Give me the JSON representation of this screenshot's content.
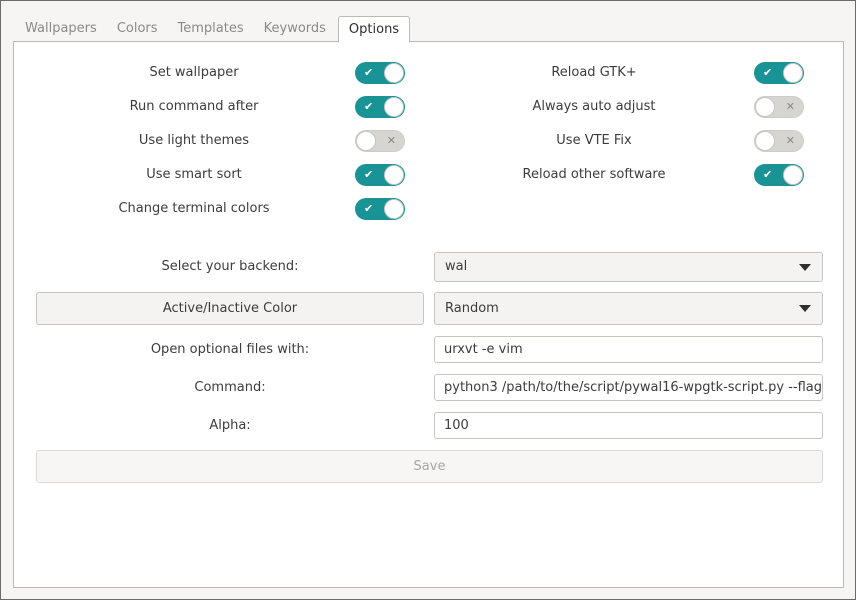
{
  "tabs": [
    {
      "label": "Wallpapers",
      "active": false
    },
    {
      "label": "Colors",
      "active": false
    },
    {
      "label": "Templates",
      "active": false
    },
    {
      "label": "Keywords",
      "active": false
    },
    {
      "label": "Options",
      "active": true
    }
  ],
  "options": {
    "left": [
      {
        "label": "Set wallpaper",
        "on": true
      },
      {
        "label": "Run command after",
        "on": true
      },
      {
        "label": "Use light themes",
        "on": false
      },
      {
        "label": "Use smart sort",
        "on": true
      },
      {
        "label": "Change terminal colors",
        "on": true
      }
    ],
    "right": [
      {
        "label": "Reload GTK+",
        "on": true
      },
      {
        "label": "Always auto adjust",
        "on": false
      },
      {
        "label": "Use VTE Fix",
        "on": false
      },
      {
        "label": "Reload other software",
        "on": true
      }
    ],
    "on_mark": "✔",
    "off_mark": "✕"
  },
  "form": {
    "backend_label": "Select your backend:",
    "backend_value": "wal",
    "active_inactive_button": "Active/Inactive Color",
    "color_mode_value": "Random",
    "open_files_label": "Open optional files with:",
    "open_files_value": "urxvt -e vim",
    "command_label": "Command:",
    "command_value": "python3 /path/to/the/script/pywal16-wpgtk-script.py --flag",
    "alpha_label": "Alpha:",
    "alpha_value": "100",
    "save_label": "Save"
  },
  "colors": {
    "accent": "#1a9396",
    "switch_off": "#d7d5d2"
  }
}
